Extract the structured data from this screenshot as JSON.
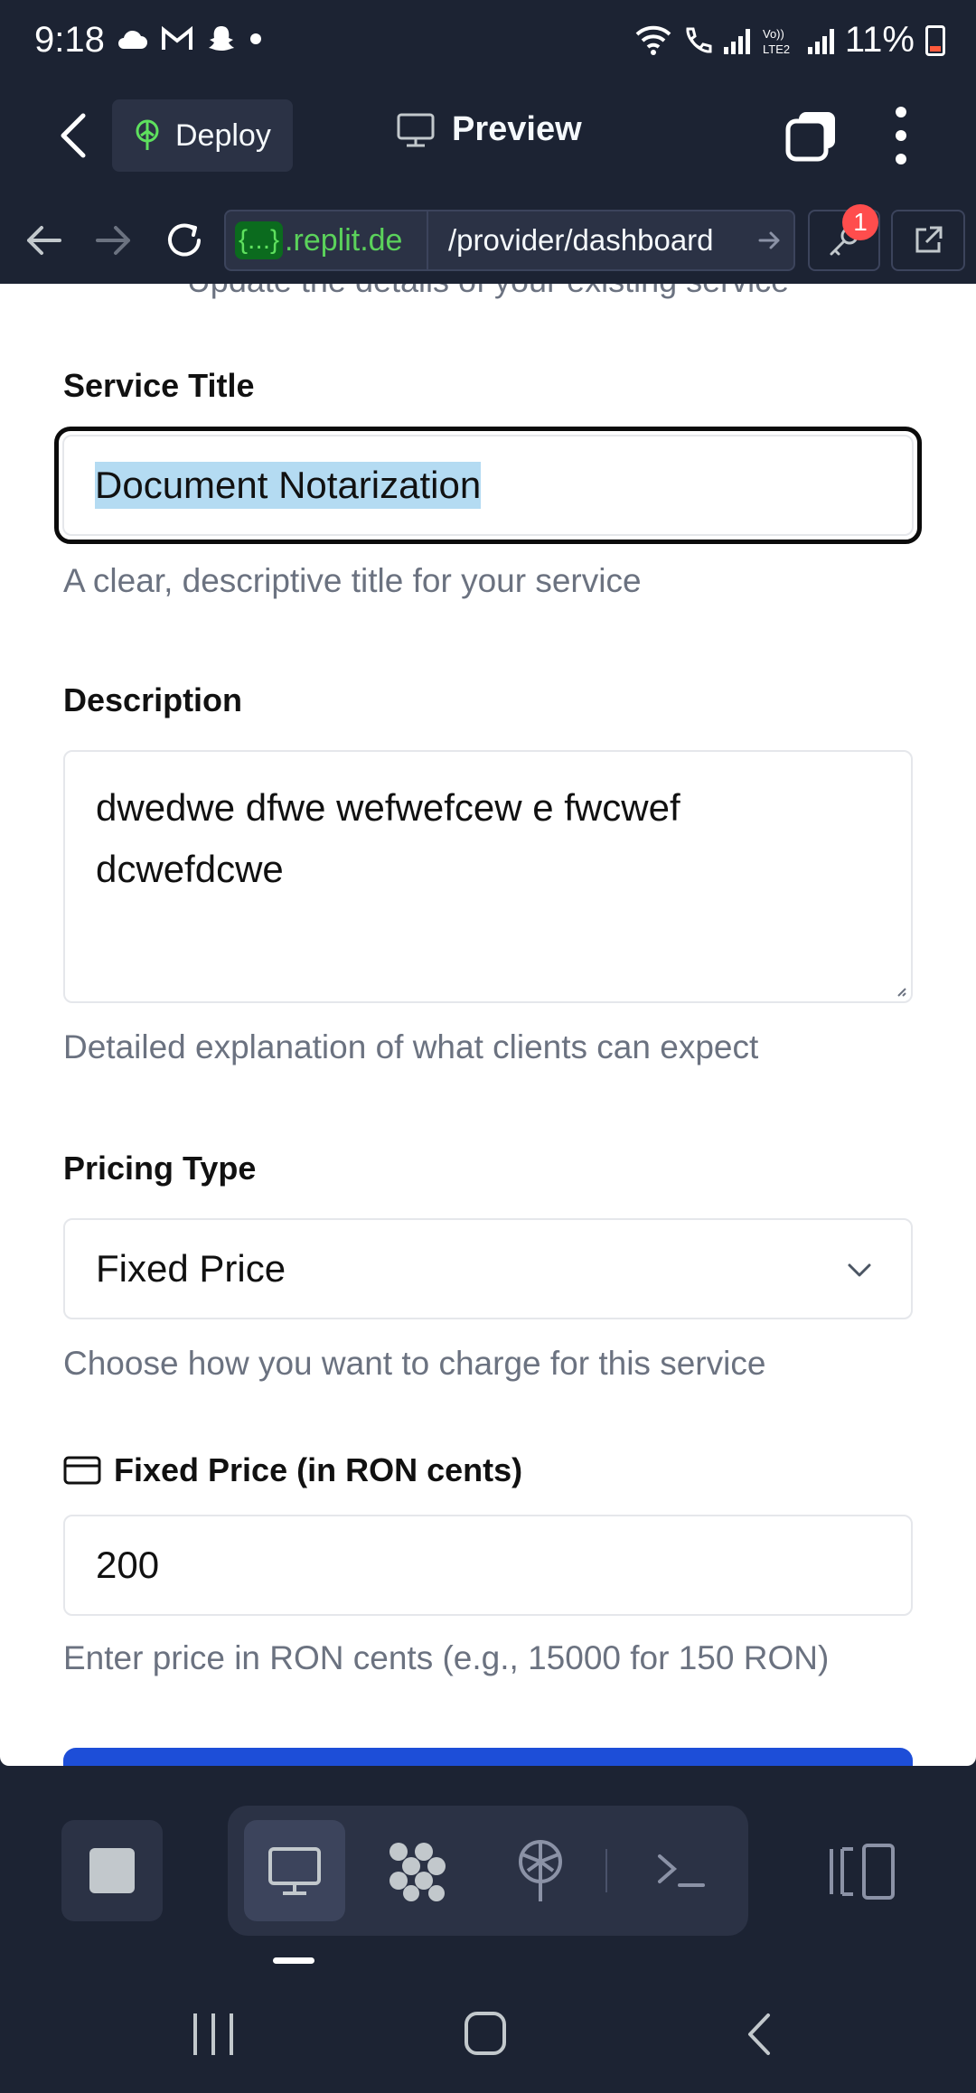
{
  "status_bar": {
    "time": "9:18",
    "network_label": "Vo)) LTE2",
    "battery": "11%"
  },
  "toolbar": {
    "deploy_label": "Deploy",
    "preview_label": "Preview"
  },
  "url_bar": {
    "host_bracket": "{...}",
    "host": ".replit.de",
    "path": "/provider/dashboard",
    "key_badge_count": "1"
  },
  "form": {
    "subtitle": "Update the details of your existing service",
    "title_label": "Service Title",
    "title_value": "Document Notarization",
    "title_hint": "A clear, descriptive title for your service",
    "description_label": "Description",
    "description_line1": "dwedwe dfwe wefwefcew e fwcwef",
    "description_line2": "dcwefdcwe",
    "description_hint": "Detailed explanation of what clients can expect",
    "pricing_label": "Pricing Type",
    "pricing_value": "Fixed Price",
    "pricing_hint": "Choose how you want to charge for this service",
    "price_label": "Fixed Price (in RON cents)",
    "price_value": "200",
    "price_hint": "Enter price in RON cents (e.g., 15000 for 150 RON)"
  },
  "colors": {
    "app_bg": "#1c2333",
    "panel": "#2b3245",
    "accent_blue": "#1d4ed8",
    "selection": "#b4dbf2",
    "badge_red": "#ff4d4d"
  }
}
